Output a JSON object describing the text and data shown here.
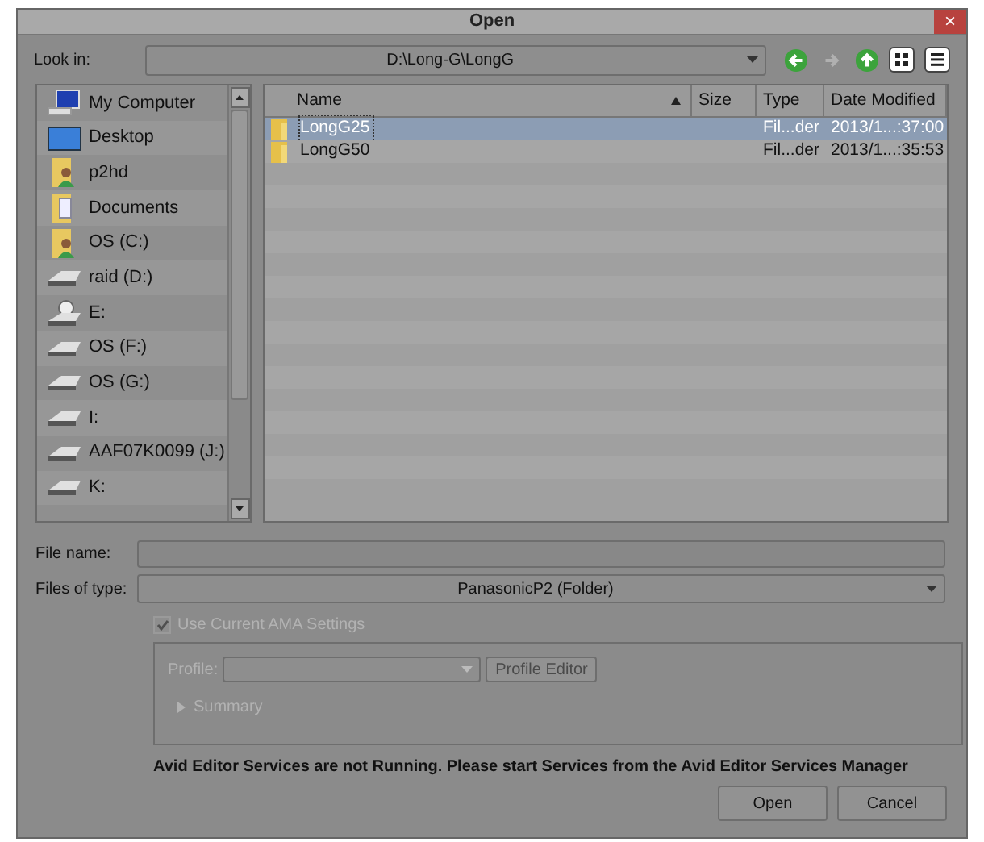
{
  "window": {
    "title": "Open",
    "close": "×"
  },
  "look_in": {
    "label": "Look in:",
    "value": "D:\\Long-G\\LongG"
  },
  "nav_buttons": [
    {
      "kind": "back",
      "disabled": false
    },
    {
      "kind": "forward",
      "disabled": true
    },
    {
      "kind": "up",
      "disabled": false
    },
    {
      "kind": "icons",
      "disabled": false
    },
    {
      "kind": "list",
      "disabled": false
    }
  ],
  "sidebar": {
    "items": [
      {
        "label": "My Computer",
        "kind": "computer"
      },
      {
        "label": "Desktop",
        "kind": "desktop"
      },
      {
        "label": "p2hd",
        "kind": "user-folder"
      },
      {
        "label": "Documents",
        "kind": "doc-folder"
      },
      {
        "label": "OS (C:)",
        "kind": "user-folder"
      },
      {
        "label": "raid (D:)",
        "kind": "drive"
      },
      {
        "label": "E:",
        "kind": "cd-drive"
      },
      {
        "label": "OS (F:)",
        "kind": "drive"
      },
      {
        "label": "OS (G:)",
        "kind": "drive"
      },
      {
        "label": "I:",
        "kind": "drive"
      },
      {
        "label": "AAF07K0099 (J:)",
        "kind": "drive"
      },
      {
        "label": "K:",
        "kind": "drive"
      }
    ]
  },
  "table": {
    "columns": [
      {
        "label": "Name",
        "sorted": true
      },
      {
        "label": "Size",
        "sorted": false
      },
      {
        "label": "Type",
        "sorted": false
      },
      {
        "label": "Date Modified",
        "sorted": false
      }
    ],
    "rows": [
      {
        "name": "LongG25",
        "type": "Fil...der",
        "date": "2013/1...:37:00",
        "selected": true
      },
      {
        "name": "LongG50",
        "type": "Fil...der",
        "date": "2013/1...:35:53",
        "selected": false
      }
    ]
  },
  "file_name": {
    "label": "File name:"
  },
  "files_of_type": {
    "label": "Files of type:",
    "value": "PanasonicP2 (Folder)"
  },
  "ama_checkbox": {
    "label": "Use Current AMA Settings",
    "checked": true,
    "disabled": true
  },
  "profile": {
    "label": "Profile:",
    "button": "Profile Editor",
    "summary": "Summary",
    "disabled": true
  },
  "message": "Avid Editor Services are not Running. Please start Services from the Avid Editor Services Manager",
  "buttons": [
    "Open",
    "Cancel"
  ]
}
